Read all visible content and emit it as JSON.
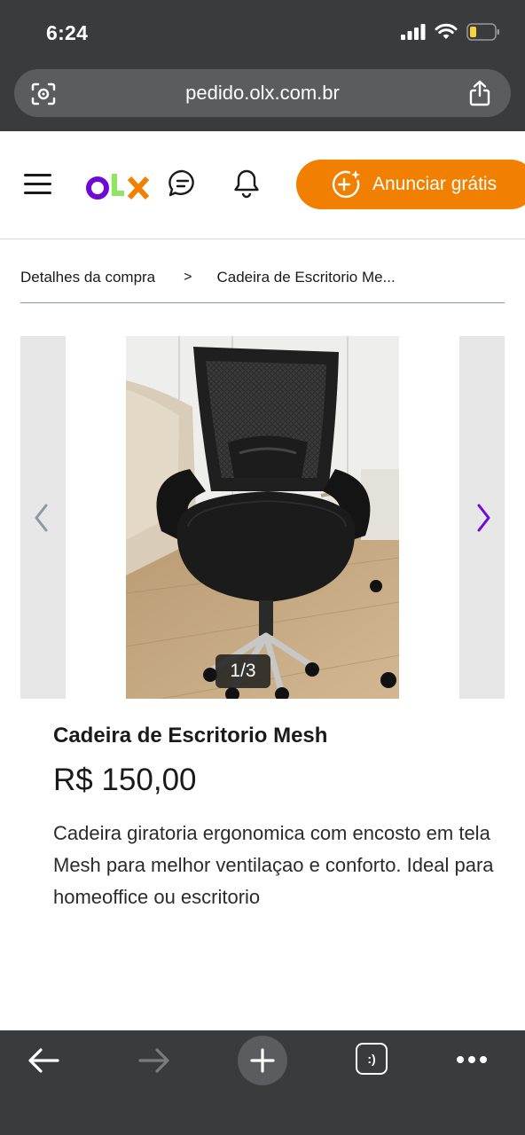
{
  "status_bar": {
    "time": "6:24"
  },
  "browser": {
    "url": "pedido.olx.com.br",
    "tabs_icon_label": ":)"
  },
  "header": {
    "logo_letters": [
      "o",
      "L",
      "x"
    ],
    "cta_label": "Anunciar grátis",
    "brand_colors": {
      "purple": "#6e0ad6",
      "orange": "#f28000",
      "green": "#8ce563"
    }
  },
  "breadcrumb": {
    "items": [
      "Detalhes da compra",
      "Cadeira de Escritorio Me..."
    ],
    "separator": ">"
  },
  "gallery": {
    "counter": "1/3",
    "current_index": 1,
    "total": 3
  },
  "product": {
    "title": "Cadeira de Escritorio Mesh",
    "price": "R$ 150,00",
    "description": "Cadeira giratoria ergonomica com encosto em tela Mesh para melhor ventilaçao e conforto. Ideal para homeoffice ou escritorio"
  },
  "icons": [
    "signal-icon",
    "wifi-icon",
    "battery-icon",
    "lens-icon",
    "share-icon",
    "menu-icon",
    "chat-icon",
    "bell-icon",
    "sparkle-plus-icon",
    "chevron-left-icon",
    "chevron-right-icon",
    "back-arrow-icon",
    "forward-arrow-icon",
    "plus-icon",
    "tabs-icon",
    "more-icon"
  ]
}
